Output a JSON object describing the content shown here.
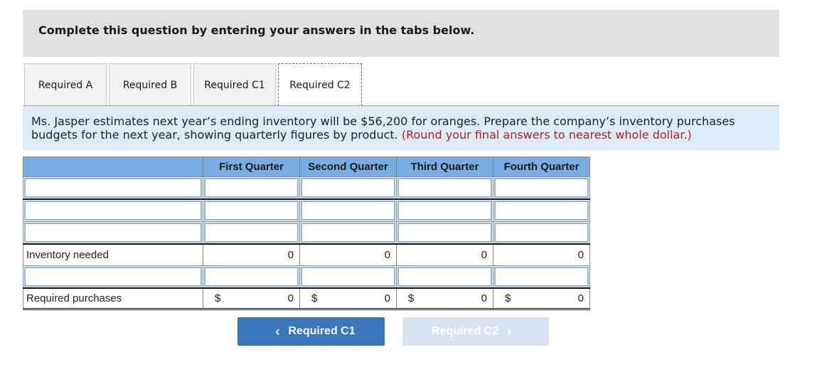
{
  "instructions": "Complete this question by entering your answers in the tabs below.",
  "tabs": [
    {
      "label": "Required A",
      "active": false
    },
    {
      "label": "Required B",
      "active": false
    },
    {
      "label": "Required C1",
      "active": false
    },
    {
      "label": "Required C2",
      "active": true
    }
  ],
  "question": {
    "text": "Ms. Jasper estimates next year’s ending inventory will be $56,200 for oranges. Prepare the company’s inventory purchases budgets for the next year, showing quarterly figures by product.",
    "note": "(Round your final answers to nearest whole dollar.)"
  },
  "table": {
    "headers": [
      "",
      "First Quarter",
      "Second Quarter",
      "Third Quarter",
      "Fourth Quarter"
    ],
    "rows": [
      {
        "type": "input",
        "label": "",
        "values": [
          "",
          "",
          "",
          ""
        ]
      },
      {
        "type": "input",
        "label": "",
        "values": [
          "",
          "",
          "",
          ""
        ]
      },
      {
        "type": "input",
        "label": "",
        "values": [
          "",
          "",
          "",
          ""
        ]
      },
      {
        "type": "static",
        "label": "Inventory needed",
        "values": [
          "0",
          "0",
          "0",
          "0"
        ]
      },
      {
        "type": "input",
        "label": "",
        "values": [
          "",
          "",
          "",
          ""
        ]
      },
      {
        "type": "total",
        "label": "Required purchases",
        "currency": "$",
        "values": [
          "0",
          "0",
          "0",
          "0"
        ]
      }
    ]
  },
  "nav": {
    "prev_label": "Required C1",
    "next_label": "Required C2",
    "prev_icon": "chevron-left-icon",
    "next_icon": "chevron-right-icon"
  },
  "colors": {
    "header_bg": "#78ade3",
    "question_bg": "#dcebf7",
    "note_red": "#b22222",
    "button_blue": "#3a76bb",
    "button_disabled": "#d7e3f1"
  }
}
